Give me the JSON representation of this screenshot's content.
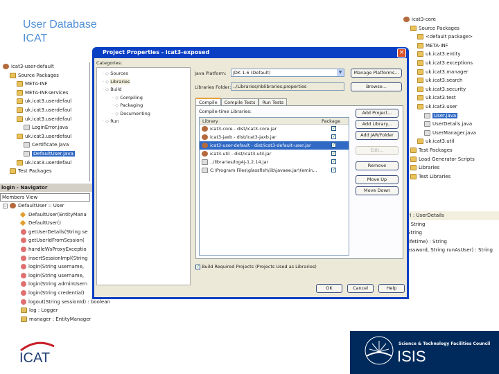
{
  "slide": {
    "title_line1": "User Database",
    "title_line2": "ICAT"
  },
  "left_tree": {
    "items": [
      {
        "label": "icat3-user-default",
        "icon": "project-icon",
        "indent": 0
      },
      {
        "label": "Source Packages",
        "icon": "folder-icon",
        "indent": 1
      },
      {
        "label": "META-INF",
        "icon": "package-icon",
        "indent": 2
      },
      {
        "label": "META-INF.services",
        "icon": "package-icon",
        "indent": 2
      },
      {
        "label": "uk.icat3.userdefaul",
        "icon": "package-icon",
        "indent": 2
      },
      {
        "label": "uk.icat3.userdefaul",
        "icon": "package-icon",
        "indent": 2
      },
      {
        "label": "uk.icat3.userdefaul",
        "icon": "package-icon",
        "indent": 2
      },
      {
        "label": "LoginError.java",
        "icon": "java-file-icon",
        "indent": 3
      },
      {
        "label": "uk.icat3.userdefaul",
        "icon": "package-icon",
        "indent": 2
      },
      {
        "label": "Certificate.java",
        "icon": "java-file-icon",
        "indent": 3
      },
      {
        "label": "DefaultUser.java",
        "icon": "java-file-icon",
        "indent": 3,
        "selected": true
      },
      {
        "label": "uk.icat3.userdefaul",
        "icon": "package-icon",
        "indent": 2
      },
      {
        "label": "Test Packages",
        "icon": "folder-icon",
        "indent": 1
      }
    ]
  },
  "navigator": {
    "title": "login - Navigator",
    "view": "Members View",
    "root": "DefaultUser :: User",
    "members": [
      {
        "label": "DefaultUser(EntityMana",
        "icon": "constructor-icon"
      },
      {
        "label": "DefaultUser()",
        "icon": "constructor-icon"
      },
      {
        "label": "getUserDetails(String se",
        "icon": "method-icon"
      },
      {
        "label": "getUserIdFromSession(",
        "icon": "method-icon"
      },
      {
        "label": "handleWsProxyExceptio",
        "icon": "method-icon"
      },
      {
        "label": "insertSessionImpl(String",
        "icon": "method-icon"
      },
      {
        "label": "login(String username, ",
        "icon": "method-icon"
      },
      {
        "label": "login(String username, ",
        "icon": "method-icon"
      },
      {
        "label": "login(String adminUsern",
        "icon": "method-icon"
      },
      {
        "label": "login(String credential)",
        "icon": "method-icon"
      },
      {
        "label": "logout(String sessionId) : boolean",
        "icon": "method-icon"
      },
      {
        "label": "log : Logger",
        "icon": "field-icon"
      },
      {
        "label": "manager : EntityManager",
        "icon": "field-icon"
      }
    ]
  },
  "right_tree": {
    "items": [
      {
        "label": "icat3-core",
        "icon": "project-icon",
        "indent": 0
      },
      {
        "label": "Source Packages",
        "icon": "folder-icon",
        "indent": 1
      },
      {
        "label": "<default package>",
        "icon": "package-icon",
        "indent": 2
      },
      {
        "label": "META-INF",
        "icon": "package-icon",
        "indent": 2
      },
      {
        "label": "uk.icat3.entity",
        "icon": "package-icon",
        "indent": 2
      },
      {
        "label": "uk.icat3.exceptions",
        "icon": "package-icon",
        "indent": 2
      },
      {
        "label": "uk.icat3.manager",
        "icon": "package-icon",
        "indent": 2
      },
      {
        "label": "uk.icat3.search",
        "icon": "package-icon",
        "indent": 2
      },
      {
        "label": "uk.icat3.security",
        "icon": "package-icon",
        "indent": 2
      },
      {
        "label": "uk.icat3.test",
        "icon": "package-icon",
        "indent": 2
      },
      {
        "label": "uk.icat3.user",
        "icon": "package-icon",
        "indent": 2
      },
      {
        "label": "User.java",
        "icon": "java-file-icon",
        "indent": 3,
        "selected": true
      },
      {
        "label": "UserDetails.java",
        "icon": "java-file-icon",
        "indent": 3
      },
      {
        "label": "UserManager.java",
        "icon": "java-file-icon",
        "indent": 3
      },
      {
        "label": "uk.icat3.util",
        "icon": "package-icon",
        "indent": 2
      },
      {
        "label": "Test Packages",
        "icon": "folder-icon",
        "indent": 1
      },
      {
        "label": "Load Generator Scripts",
        "icon": "folder-icon",
        "indent": 1
      },
      {
        "label": "Libraries",
        "icon": "folder-icon",
        "indent": 1
      },
      {
        "label": "Test Libraries",
        "icon": "folder-icon",
        "indent": 1
      }
    ]
  },
  "right_members": [
    "r) : UserDetails",
    ": String",
    "String",
    "lifetime) : String",
    "assword, String runAsUser) : String"
  ],
  "dialog": {
    "title": "Project Properties - icat3-exposed",
    "categories_label": "Categories:",
    "categories": [
      {
        "label": "Sources",
        "indent": 0
      },
      {
        "label": "Libraries",
        "indent": 0,
        "selected": true
      },
      {
        "label": "Build",
        "indent": 0
      },
      {
        "label": "Compiling",
        "indent": 1
      },
      {
        "label": "Packaging",
        "indent": 1
      },
      {
        "label": "Documenting",
        "indent": 1
      },
      {
        "label": "Run",
        "indent": 0
      }
    ],
    "java_platform_label": "Java Platform:",
    "java_platform_value": "JDK 1.6 (Default)",
    "manage_platforms": "Manage Platforms...",
    "libraries_folder_label": "Libraries Folder:",
    "libraries_folder_value": "../Libraries/nblibraries.properties",
    "browse": "Browse...",
    "tabs": [
      "Compile",
      "Compile Tests",
      "Run Tests"
    ],
    "compile_libs_label": "Compile-time Libraries:",
    "col_library": "Library",
    "col_package": "Package",
    "libraries": [
      {
        "label": "icat3-core - dist/icat3-core.jar",
        "icon": "project-icon",
        "checked": true
      },
      {
        "label": "icat3-jaxb - dist/icat3-jaxb.jar",
        "icon": "project-icon",
        "checked": true
      },
      {
        "label": "icat3-user-default - dist/icat3-default-user.jar",
        "icon": "project-icon",
        "checked": true,
        "selected": true
      },
      {
        "label": "icat3-util - dist/icat3-util.jar",
        "icon": "project-icon",
        "checked": true
      },
      {
        "label": "../libraries/log4j-1.2.14.jar",
        "icon": "jar-icon",
        "checked": true
      },
      {
        "label": "C:\\Program Files\\glassfish\\lib\\javaee.jar\\(emin...",
        "icon": "jar-icon",
        "checked": true
      }
    ],
    "buttons": [
      "Add Project...",
      "Add Library...",
      "Add JAR/Folder",
      "Edit...",
      "Remove",
      "Move Up",
      "Move Down"
    ],
    "build_checkbox": "Build Required Projects (Projects Used as Libraries)",
    "ok": "OK",
    "cancel": "Cancel",
    "help": "Help"
  },
  "footer": {
    "icat_logo": "ICAT",
    "stfc": "Science & Technology Facilities Council",
    "isis": "ISIS"
  }
}
